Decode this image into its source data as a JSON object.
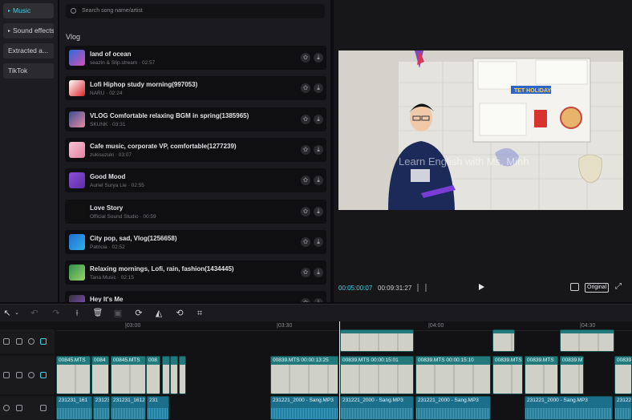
{
  "sidebar": {
    "items": [
      {
        "label": "Music",
        "active": true,
        "arrow": "▸"
      },
      {
        "label": "Sound effects",
        "active": false,
        "arrow": "▸"
      },
      {
        "label": "Extracted a...",
        "active": false,
        "arrow": ""
      },
      {
        "label": "TikTok",
        "active": false,
        "arrow": ""
      }
    ]
  },
  "music": {
    "search_placeholder": "Search song name/artist",
    "section_title": "Vlog",
    "tracks": [
      {
        "title": "land of ocean",
        "meta": "seazin & Slip.stream · 02:57",
        "thumb_colors": [
          "#2a6bd8",
          "#d64fb8"
        ]
      },
      {
        "title": "Lofi Hiphop study morning(997053)",
        "meta": "NARU · 02:24",
        "thumb_colors": [
          "#ffffff",
          "#d8262a"
        ]
      },
      {
        "title": "VLOG Comfortable relaxing BGM in spring(1385965)",
        "meta": "SKUNK · 03:31",
        "thumb_colors": [
          "#3a4f92",
          "#e98aa2"
        ]
      },
      {
        "title": "Cafe music, corporate VP, comfortable(1277239)",
        "meta": "zukisuzuki · 03:07",
        "thumb_colors": [
          "#f4c6d6",
          "#e77fa0"
        ]
      },
      {
        "title": "Good Mood",
        "meta": "Auriel Surya Lie · 02:55",
        "thumb_colors": [
          "#8e4fd6",
          "#5b2da6"
        ]
      },
      {
        "title": "Love Story",
        "meta": "Official Sound Studio · 00:59",
        "thumb_colors": [
          "#111111",
          "#111111"
        ]
      },
      {
        "title": "City pop, sad, Vlog(1256658)",
        "meta": "Patricia · 02:52",
        "thumb_colors": [
          "#1f6fd0",
          "#2fb0e8"
        ]
      },
      {
        "title": "Relaxing mornings, Lofi, rain, fashion(1434445)",
        "meta": "Tana Music · 02:15",
        "thumb_colors": [
          "#2f8f4f",
          "#9ad36a"
        ]
      },
      {
        "title": "Hey It's Me",
        "meta": "",
        "thumb_colors": [
          "#333333",
          "#8a4fd6"
        ]
      }
    ]
  },
  "player": {
    "watermark": "Learn English with Ms. Minh",
    "poster_text": "TET HOLIDAY",
    "current_time": "00:05:00:07",
    "total_time": "00:09:31:27",
    "original_label": "Original",
    "fullscreen_glyph": "⤢"
  },
  "toolbar": {
    "select_glyph": "↖",
    "undo_glyph": "↶",
    "redo_glyph": "↷",
    "split_glyph": "⟊",
    "delete_glyph": "🗑",
    "freeze_glyph": "▣",
    "speed_glyph": "⟳",
    "mirror_glyph": "◭",
    "rotate_glyph": "⟲",
    "crop_glyph": "⌗"
  },
  "timeline": {
    "ticks": [
      "|03:00",
      "|03:30",
      "|04:00",
      "|04:30"
    ],
    "video_clips": [
      "00845.MTS",
      "0084",
      "00845.MTS",
      "008",
      "00839.MTS  00:00:13:25",
      "00839.MTS  00:00:15:01",
      "00839.MTS  00:00:15:10",
      "00839.MTS",
      "00839.MTS",
      "00839.MTS",
      "00839.MTS"
    ],
    "audio_clips": [
      "231231_161",
      "231231_1612",
      "231231_1612",
      "231",
      "231221_2000 - Sang.MP3",
      "231221_2000 - Sang.MP3",
      "231221_2000 - Sang.MP3",
      "231221_2000 - Sang.MP3",
      "231221_200"
    ]
  },
  "colors": {
    "accent": "#3fd3e8",
    "video_clip": "#237a7c",
    "audio_clip": "#1c6f8a"
  }
}
